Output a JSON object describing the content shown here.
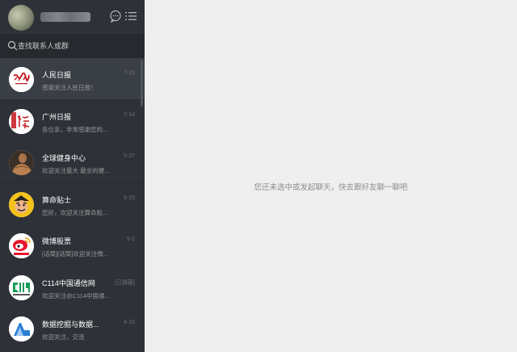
{
  "search": {
    "placeholder": "查找联系人或群"
  },
  "chats": [
    {
      "name": "人民日报",
      "preview": "感谢关注人民日报！",
      "time": "7-15",
      "avatar": "people-daily"
    },
    {
      "name": "广州日报",
      "preview": "各位亲，非常感谢您的...",
      "time": "7-14",
      "avatar": "guangzhou-daily"
    },
    {
      "name": "全球健身中心",
      "preview": "欢迎关注最大 最全的健...",
      "time": "5-27",
      "avatar": "fitness"
    },
    {
      "name": "算命贴士",
      "preview": "您好，欢迎关注算命贴...",
      "time": "5-25",
      "avatar": "fortune"
    },
    {
      "name": "微博股票",
      "preview": "[话筒][话筒]欢迎关注微...",
      "time": "5-2",
      "avatar": "weibo-stock"
    },
    {
      "name": "C114中国通信网",
      "preview": "欢迎关注@C114中国通...",
      "time": "[已屏蔽]",
      "avatar": "c114"
    },
    {
      "name": "数据挖掘与数据...",
      "preview": "欢迎关注，交流",
      "time": "4-15",
      "avatar": "data-mining"
    }
  ],
  "main": {
    "empty_tip": "您还未选中或发起聊天，快去跟好友聊一聊吧"
  },
  "colors": {
    "sidebar": "#2e3238",
    "search_bar": "#26292e",
    "main_bg": "#efefef"
  }
}
